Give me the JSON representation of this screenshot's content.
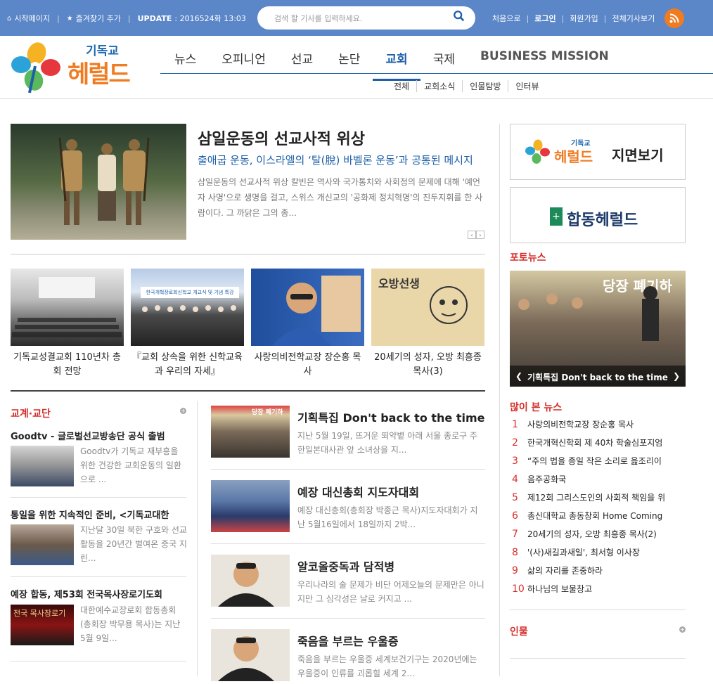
{
  "topbar": {
    "start_page": "시작페이지",
    "bookmark": "즐겨찾기 추가",
    "update_label": "UPDATE",
    "update_value": ": 2016524화 13:03",
    "search_placeholder": "검색 할 기사를 입력하세요.",
    "first": "처음으로",
    "login": "로그인",
    "join": "회원가입",
    "all_articles": "전체기사보기"
  },
  "logo": {
    "small": "기독교",
    "big": "헤럴드"
  },
  "gnb": [
    "뉴스",
    "오피니언",
    "선교",
    "논단",
    "교회",
    "국제",
    "BUSINESS MISSION"
  ],
  "subnav": [
    "전체",
    "교회소식",
    "인물탐방",
    "인터뷰"
  ],
  "lead": {
    "title": "삼일운동의 선교사적 위상",
    "subtitle": "출애굽 운동, 이스라엘의 ‘탈(脫) 바벨론 운동’과 공통된 메시지",
    "body": "삼일운동의 선교사적 위상 칼빈은 역사와 국가통치와 사회정의 문제에 대해 '예언자 사명'으로 생명을 걸고, 스위스 개신교의 '공화제 정치혁명'의 진두지휘를 한 사람이다. 그 까닭은 그의 종..."
  },
  "thumbs": [
    {
      "caption": "기독교성결교회 110년차 총회 전망"
    },
    {
      "caption": "『교회 상속을 위한 신학교육과 우리의 자세』",
      "banner": "한국개혁장로회신학교 개교식 및 기념 특강"
    },
    {
      "caption": "사랑의비전학교장 장순홍 목사"
    },
    {
      "caption": "20세기의 성자, 오방 최흥종 목사(3)",
      "img_text": "오방선생"
    }
  ],
  "left_section": {
    "title": "교계·교단",
    "items": [
      {
        "title": "Goodtv - 글로벌선교방송단 공식 출범",
        "body": "Goodtv가 기독교 재부흥을 위한 건강한 교회운동의 일환으로 ..."
      },
      {
        "title": "통일을 위한 지속적인 준비, <기독교대한",
        "body": "지난달 30일 북한 구호와 선교활동을 20년간 벌여온 중국 지린..."
      },
      {
        "title": "예장 합동, 제53회 전국목사장로기도회",
        "body": "대한예수교장로회 합동총회(총회장 박무용 목사)는 지난 5월 9일...",
        "img_text": "전국 목사장로기"
      }
    ]
  },
  "mid_section": [
    {
      "title": "기획특집 Don't back to the time",
      "body": "지난 5월 19일, 뜨거운 뙤약볕 아래 서울 종로구 주한일본대사관 앞 소녀상을 지...",
      "img_text": "당장 폐기하"
    },
    {
      "title": "예장 대신총회 지도자대회",
      "body": "예장 대신총회(총회장 박종근 목사)지도자대회가 지난 5월16일에서 18일까지 2박..."
    },
    {
      "title": "알코올중독과 담적병",
      "body": "우리나라의 술 문제가 비단 어제오늘의 문제만은 아니지만 그 심각성은 날로 커지고 ..."
    },
    {
      "title": "죽음을 부르는 우울증",
      "body": "죽음을 부르는 우울증 세계보건기구는 2020년에는 우울증이 인류를 괴롭힐 세계 2..."
    }
  ],
  "right": {
    "paper_logo_small": "기독교",
    "paper_logo_big": "헤럴드",
    "paper_label": "지면보기",
    "hapdong_label": "합동헤럴드",
    "photo_title": "포토뉴스",
    "photo_img_text": "당장 폐기하",
    "photo_caption": "기획특집 Don't back to the time",
    "popular_title": "많이 본 뉴스",
    "popular": [
      "사랑의비전학교장 장순홍 목사",
      "한국개혁신학회 제 40차 학술심포지엄",
      "“주의 법을 종일 작은 소리로 읊조리이",
      "음주공화국",
      "제12회 그리스도인의 사회적 책임을 위",
      "총신대학교 총동창회 Home Coming",
      "20세기의 성자, 오방 최흥종 목사(2)",
      "'(사)새길과새일', 최서형 이사장",
      "삶의 자리를 존중하라",
      "하나님의 보물창고"
    ],
    "people_title": "인물"
  },
  "colors": {
    "topbar": "#5b86c7",
    "accent_red": "#d5302b",
    "accent_blue": "#1d5fa8",
    "rss": "#f07c22"
  }
}
